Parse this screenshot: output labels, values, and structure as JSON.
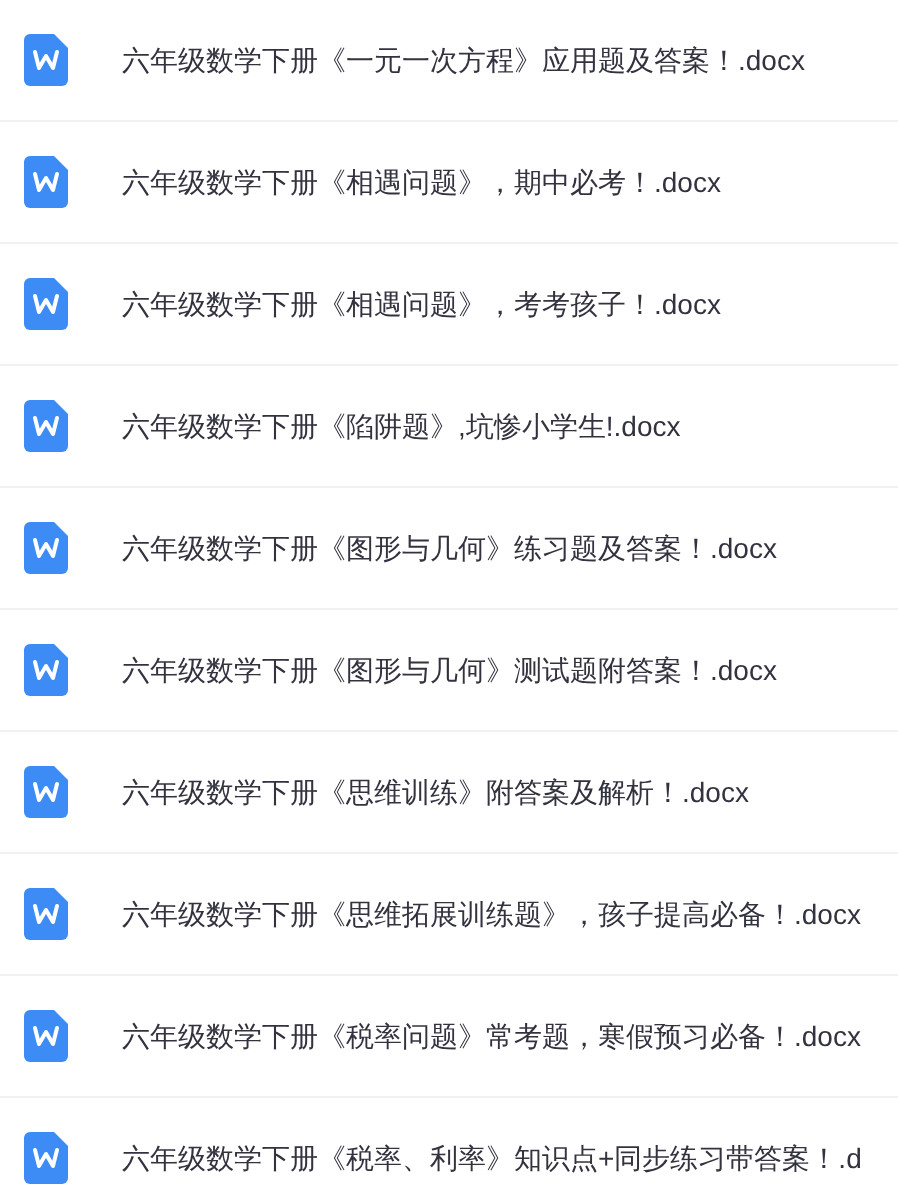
{
  "files": [
    {
      "name": "六年级数学下册《一元一次方程》应用题及答案！.docx"
    },
    {
      "name": "六年级数学下册《相遇问题》，期中必考！.docx"
    },
    {
      "name": "六年级数学下册《相遇问题》，考考孩子！.docx"
    },
    {
      "name": "六年级数学下册《陷阱题》,坑惨小学生!.docx"
    },
    {
      "name": "六年级数学下册《图形与几何》练习题及答案！.docx"
    },
    {
      "name": "六年级数学下册《图形与几何》测试题附答案！.docx"
    },
    {
      "name": "六年级数学下册《思维训练》附答案及解析！.docx"
    },
    {
      "name": "六年级数学下册《思维拓展训练题》，孩子提高必备！.docx"
    },
    {
      "name": "六年级数学下册《税率问题》常考题，寒假预习必备！.docx"
    },
    {
      "name": "六年级数学下册《税率、利率》知识点+同步练习带答案！.d"
    }
  ]
}
